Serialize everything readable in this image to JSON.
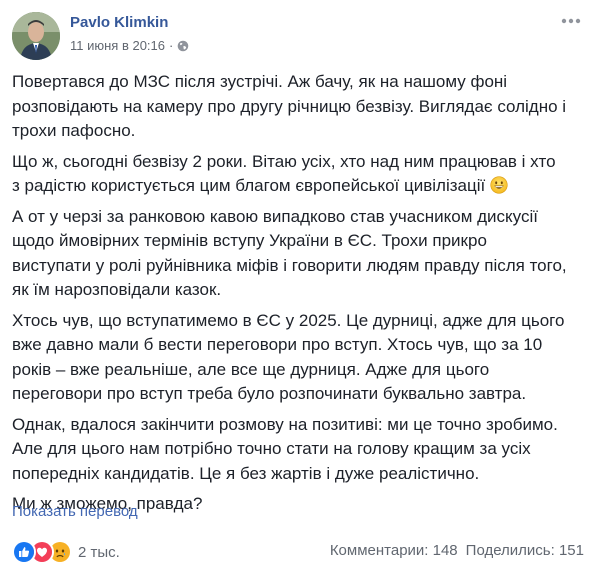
{
  "post": {
    "author": "Pavlo Klimkin",
    "timestamp": "11 июня в 20:16",
    "separator": "·",
    "privacy_icon": "globe-icon",
    "paragraphs": [
      "Повертався до МЗС після зустрічі. Аж бачу, як на нашому фоні\nрозповідають на камеру про другу річницю безвізу. Виглядає солідно і\nтрохи пафосно.",
      "Що ж, сьогодні безвізу 2 роки. Вітаю усіх, хто над ним працював і хто\nз радістю користується цим благом європейської цивілізації",
      "А от у черзі за ранковою кавою випадково став учасником дискусії\nщодо ймовірних термінів вступу України в ЄС. Трохи прикро\nвиступати у ролі руйнівника міфів і говорити людям правду після того,\nяк їм нарозповідали казок.",
      "Хтось чув, що вступатимемо в ЄС у 2025. Це дурниці, адже для цього\nвже давно мали б вести переговори про вступ. Хтось чув, що за 10\nроків – вже реальніше, але все ще дурниця. Адже для цього\nпереговори про вступ треба було розпочинати буквально завтра.",
      "Однак, вдалося закінчити розмову на позитиві: ми це точно зробимо.\nАле для цього нам потрібно точно стати на голову кращим за усіх\nпопередніх кандидатів. Це я без жартів і дуже реалістично.",
      "Ми ж зможемо, правда?"
    ],
    "see_translation": "Показать перевод"
  },
  "footer": {
    "reactions": [
      "like-icon",
      "love-icon",
      "sad-icon"
    ],
    "reaction_count": "2 тыс.",
    "comments": "Комментарии: 148",
    "shares": "Поделились: 151"
  },
  "colors": {
    "link": "#365899",
    "translation_link": "#4267b2",
    "meta": "#616770",
    "text": "#1d2129",
    "like": "#1877f2",
    "love": "#f33e58",
    "sad": "#f7b125"
  }
}
